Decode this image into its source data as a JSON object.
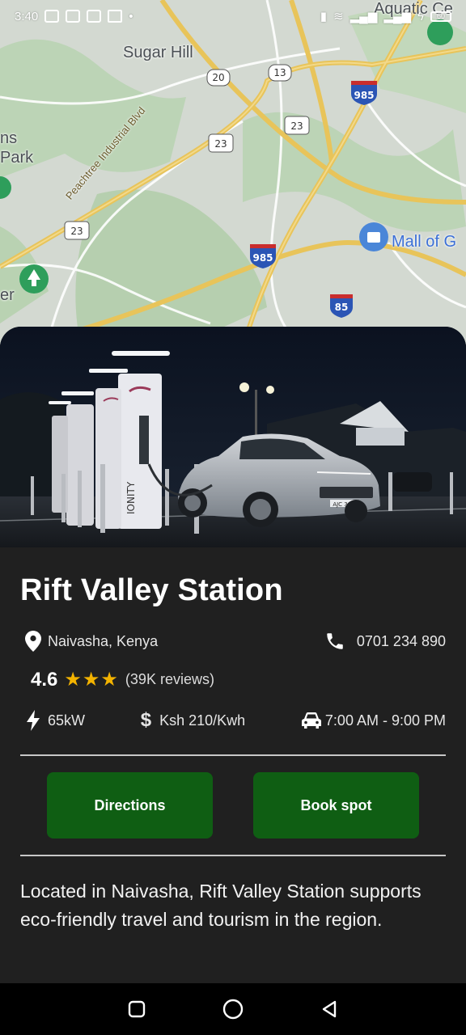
{
  "status_bar": {
    "time": "3:40",
    "battery": "60",
    "icons": [
      "gallery-icon",
      "news-icon",
      "linkedin-icon",
      "gmail-icon",
      "dot-icon",
      "vibrate-icon",
      "wifi-icon",
      "signal-icon",
      "signal-icon",
      "charging-icon",
      "battery-icon"
    ]
  },
  "map": {
    "labels": {
      "sugar_hill": "Sugar Hill",
      "road_peachtree": "Peachtree Industrial Blvd",
      "ns": "ns",
      "park": "Park",
      "er": "er",
      "mall": "Mall of G",
      "aquatic": "Aquatic Ce"
    },
    "shields": [
      "20",
      "13",
      "23",
      "23",
      "23",
      "985",
      "985",
      "85"
    ]
  },
  "station": {
    "name": "Rift Valley Station",
    "location": "Naivasha, Kenya",
    "phone": "0701 234 890",
    "rating": "4.6",
    "stars": "★★★",
    "reviews": "(39K reviews)",
    "power": "65kW",
    "price": "Ksh 210/Kwh",
    "hours": "7:00 AM - 9:00 PM",
    "description": "Located in Naivasha, Rift Valley Station supports eco-friendly travel and tourism in the region."
  },
  "hero": {
    "charger_brand": "IONITY",
    "plate": "AJC 300"
  },
  "actions": {
    "directions_label": "Directions",
    "book_label": "Book spot"
  },
  "colors": {
    "card_bg": "#202020",
    "button_green": "#0f5e13",
    "star_gold": "#f3b300"
  },
  "nav": {
    "icons": [
      "recents-square-icon",
      "home-circle-icon",
      "back-triangle-icon"
    ]
  }
}
